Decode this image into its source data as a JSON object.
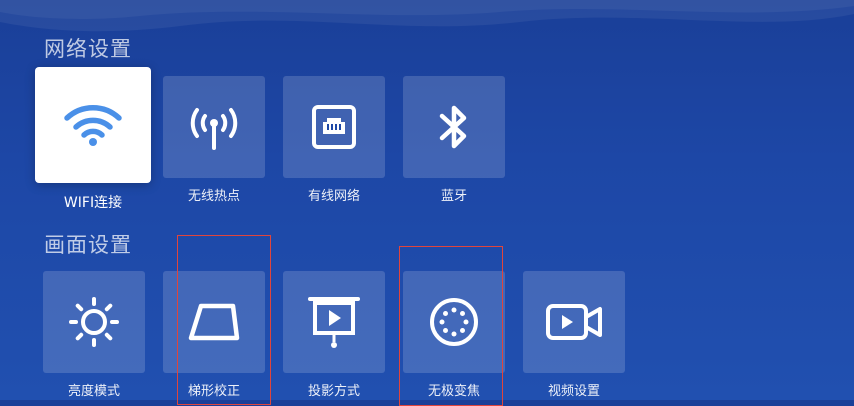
{
  "sections": [
    {
      "title": "网络设置",
      "items": [
        {
          "label": "WIFI连接",
          "icon": "wifi-icon",
          "selected": true
        },
        {
          "label": "无线热点",
          "icon": "hotspot-icon"
        },
        {
          "label": "有线网络",
          "icon": "ethernet-icon"
        },
        {
          "label": "蓝牙",
          "icon": "bluetooth-icon"
        }
      ]
    },
    {
      "title": "画面设置",
      "items": [
        {
          "label": "亮度模式",
          "icon": "brightness-icon"
        },
        {
          "label": "梯形校正",
          "icon": "keystone-icon",
          "highlighted": true
        },
        {
          "label": "投影方式",
          "icon": "projection-icon"
        },
        {
          "label": "无极变焦",
          "icon": "zoom-focus-icon",
          "highlighted": true
        },
        {
          "label": "视频设置",
          "icon": "video-camera-icon"
        }
      ]
    }
  ],
  "colors": {
    "background": "#1d47a6",
    "selected_tile": "#ffffff",
    "wifi_icon": "#4a90e8",
    "highlight_border": "#e0453c"
  }
}
